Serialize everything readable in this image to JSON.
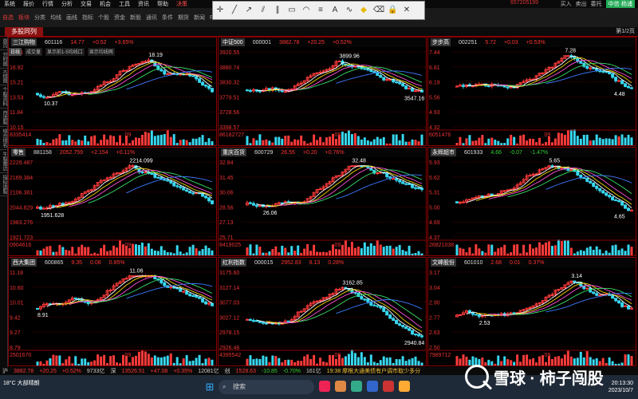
{
  "menu": {
    "items": [
      "系统",
      "报价",
      "行情",
      "分析",
      "交易",
      "机会",
      "工具",
      "资讯",
      "帮助",
      "决策"
    ],
    "phone": "657205199",
    "right": [
      "买入",
      "卖出",
      "委托",
      "中信·杨浦"
    ]
  },
  "toolbar2": [
    "自选",
    "板块",
    "分类",
    "均线",
    "画线",
    "指标",
    "个股",
    "资金",
    "新股",
    "通讯",
    "条件",
    "期货",
    "新闻",
    "F10",
    "AI"
  ],
  "tab": {
    "label": "多股同列",
    "pager": "第1/2页"
  },
  "sidebar": [
    "首页",
    "分时图",
    "K线图",
    "个股资料",
    "自选股",
    "综合排名",
    "牛股雷达",
    "指标选股"
  ],
  "controls": {
    "period": "日线",
    "indicator": "成交量",
    "opt1": "显示前1-5均线口",
    "opt2": "显示均线网"
  },
  "panels": [
    {
      "name": "三江购物",
      "code": "601116",
      "price": "14.77",
      "chg": "+0.52",
      "pct": "+3.65%",
      "dir": "pos",
      "y_ticks": [
        "18.61",
        "16.92",
        "15.21",
        "13.53",
        "11.84",
        "10.15"
      ],
      "vol_label": "8335414",
      "high": "18.19",
      "low": "10.37",
      "month": "09"
    },
    {
      "name": "中证500",
      "code": "000001",
      "price": "3882.78",
      "chg": "+20.25",
      "pct": "+0.52%",
      "dir": "pos",
      "y_ticks": [
        "3920.55",
        "3880.74",
        "3830.32",
        "3779.51",
        "3728.56",
        "3398.57"
      ],
      "vol_label": "86182727",
      "high": "3899.96",
      "low": "3547.16",
      "month": "09"
    },
    {
      "name": "步步高",
      "code": "002251",
      "price": "5.72",
      "chg": "+0.03",
      "pct": "+0.53%",
      "dir": "pos",
      "y_ticks": [
        "7.44",
        "6.81",
        "6.19",
        "5.56",
        "4.93",
        "4.32"
      ],
      "vol_label": "6051476",
      "high": "7.28",
      "low": "4.48",
      "month": "09"
    },
    {
      "name": "零售",
      "code": "881158",
      "price": "2052.759",
      "chg": "+2.154",
      "pct": "+0.11%",
      "dir": "pos",
      "y_ticks": [
        "2229.487",
        "2169.384",
        "2106.381",
        "2044.829",
        "1983.276",
        "1921.723"
      ],
      "vol_label": "0904616",
      "high": "2214.099",
      "low": "1951.628",
      "month": "09"
    },
    {
      "name": "重庆百货",
      "code": "600729",
      "price": "26.55",
      "chg": "+0.20",
      "pct": "+0.76%",
      "dir": "pos",
      "y_ticks": [
        "32.84",
        "31.45",
        "30.06",
        "28.56",
        "27.13",
        "25.71"
      ],
      "vol_label": "8419025",
      "high": "32.48",
      "low": "26.06",
      "month": "09"
    },
    {
      "name": "永辉超市",
      "code": "601933",
      "price": "4.66",
      "chg": "-0.07",
      "pct": "-1.47%",
      "dir": "neg",
      "y_ticks": [
        "5.93",
        "5.62",
        "5.31",
        "5.00",
        "4.69",
        "4.37"
      ],
      "vol_label": "26821038",
      "high": "5.65",
      "low": "4.65",
      "month": "09"
    },
    {
      "name": "西大集团",
      "code": "600865",
      "price": "9.35",
      "chg": "0.08",
      "pct": "0.85%",
      "dir": "pos",
      "y_ticks": [
        "11.18",
        "10.60",
        "10.01",
        "9.42",
        "9.27",
        "8.79"
      ],
      "vol_label": "2501670",
      "high": "11.06",
      "low": "8.91",
      "month": "09"
    },
    {
      "name": "红利指数",
      "code": "000015",
      "price": "2952.83",
      "chg": "8.13",
      "pct": "0.28%",
      "dir": "pos",
      "y_ticks": [
        "3175.60",
        "3127.14",
        "3077.03",
        "3027.12",
        "2978.15",
        "2926.48"
      ],
      "vol_label": "4395542",
      "high": "3162.85",
      "low": "2940.84",
      "month": "09"
    },
    {
      "name": "文峰股份",
      "code": "601010",
      "price": "2.68",
      "chg": "0.01",
      "pct": "0.37%",
      "dir": "pos",
      "y_ticks": [
        "3.17",
        "3.04",
        "2.90",
        "2.77",
        "2.63",
        "2.50"
      ],
      "vol_label": "7989712",
      "high": "3.14",
      "low": "2.53",
      "month": "09"
    }
  ],
  "status": {
    "items": [
      {
        "t": "沪",
        "c": ""
      },
      {
        "t": "3882.78",
        "c": "pos"
      },
      {
        "t": "+20.25",
        "c": "pos"
      },
      {
        "t": "+0.52%",
        "c": "pos"
      },
      {
        "t": "9733亿",
        "c": ""
      },
      {
        "t": "深",
        "c": ""
      },
      {
        "t": "13526.51",
        "c": "pos"
      },
      {
        "t": "+47.08",
        "c": "pos"
      },
      {
        "t": "+0.35%",
        "c": "pos"
      },
      {
        "t": "12081亿",
        "c": ""
      },
      {
        "t": "创",
        "c": ""
      },
      {
        "t": "1528.63",
        "c": "pos"
      },
      {
        "t": "-10.85",
        "c": "neg"
      },
      {
        "t": "-0.70%",
        "c": "neg"
      },
      {
        "t": "161亿",
        "c": ""
      }
    ],
    "ticker": "19:38 摩根大通美债有户调市取少多分"
  },
  "taskbar": {
    "weather": "18°C 大部晴朗",
    "search": "搜索",
    "time": "20:13:30",
    "date": "2023/10/7"
  },
  "watermark": {
    "text": "雪球 · 柿子闯股"
  }
}
